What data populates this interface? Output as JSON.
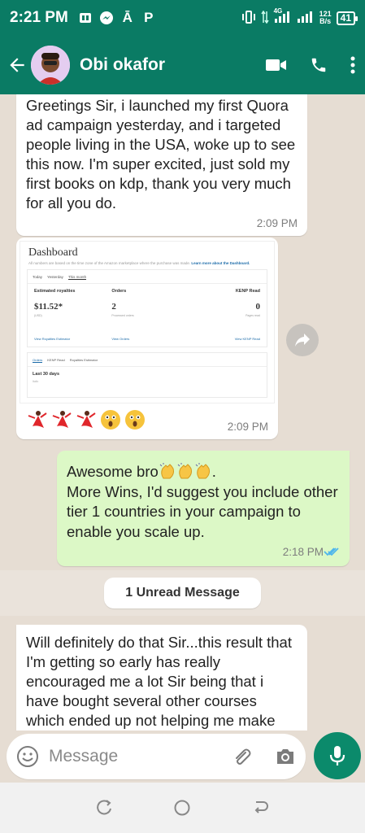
{
  "status_bar": {
    "time": "2:21 PM",
    "network_type": "4G",
    "speed_value": "121",
    "speed_unit": "B/s",
    "battery": "41"
  },
  "header": {
    "contact_name": "Obi okafor",
    "accent_color": "#0a7b64"
  },
  "messages": [
    {
      "direction": "incoming",
      "text": "Greetings Sir, i launched my first Quora ad campaign yesterday, and i targeted people living in the USA, woke up to see this now. I'm super excited, just sold my first books on kdp, thank you very much for all you do.",
      "time": "2:09 PM"
    },
    {
      "direction": "incoming",
      "type": "image",
      "time": "2:09 PM",
      "dashboard": {
        "title": "Dashboard",
        "note": "All numbers are based on the time zone of the Amazon marketplace where the purchase was made.",
        "note_link": "Learn more about the Dashboard.",
        "tabs": [
          "Today",
          "Yesterday",
          "This month"
        ],
        "metrics": [
          {
            "label": "Estimated royalties",
            "value": "$11.52*",
            "sub": "(USD)",
            "link": "View Royalties Estimator"
          },
          {
            "label": "Orders",
            "value": "2",
            "sub": "Processed orders",
            "link": "View Orders"
          },
          {
            "label": "KENP Read",
            "value": "0",
            "sub": "Pages read",
            "link": "View KENP Read"
          }
        ],
        "tabs2": [
          "Orders",
          "KENP Read",
          "Royalties Estimator"
        ],
        "range": "Last 30 days",
        "range_sub": "Italic"
      }
    },
    {
      "direction": "outgoing",
      "line1": "Awesome bro",
      "line1_end": ".",
      "text": "More Wins, I'd suggest you include other tier 1 countries in your campaign to enable you scale up.",
      "time": "2:18 PM"
    },
    {
      "direction": "incoming",
      "text": "Will definitely do that Sir...this result that I'm getting so early has really encouraged me a lot Sir being that i have bought several other courses which ended up not helping me make"
    }
  ],
  "unread_label": "1 Unread Message",
  "composer": {
    "placeholder": "Message"
  }
}
